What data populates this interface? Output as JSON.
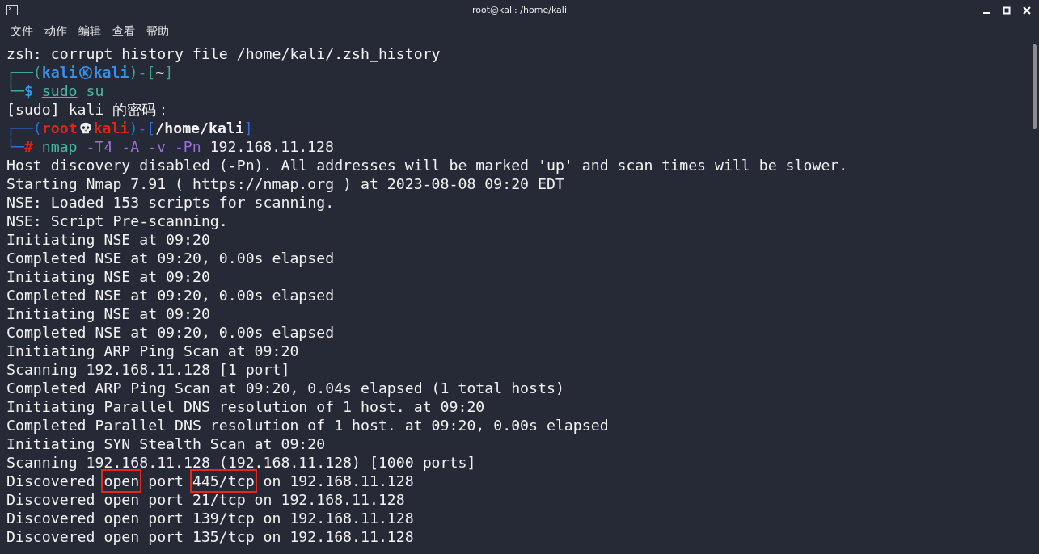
{
  "window": {
    "title": "root@kali: /home/kali"
  },
  "menu": [
    "文件",
    "动作",
    "编辑",
    "查看",
    "帮助"
  ],
  "lines": [
    {
      "kind": "output",
      "text": "zsh: corrupt history file /home/kali/.zsh_history"
    },
    {
      "kind": "prompt",
      "privileged": false,
      "open": "┌──(",
      "user": "kali",
      "host": "kali",
      "separator": ")-[",
      "path": "~",
      "close": "]",
      "corner": "└─",
      "symbol": "$",
      "command": [
        {
          "text": "sudo",
          "kind": "command",
          "underline": true
        },
        {
          "text": "su",
          "kind": "command",
          "underline": false
        }
      ]
    },
    {
      "kind": "output",
      "text": "[sudo] kali 的密码："
    },
    {
      "kind": "prompt",
      "privileged": true,
      "open": "┌──(",
      "user": "root",
      "host": "kali",
      "separator": ")-[",
      "path": "/home/kali",
      "close": "]",
      "corner": "└─",
      "symbol": "#",
      "command": [
        {
          "text": "nmap",
          "kind": "command",
          "underline": false
        },
        {
          "text": "-T4",
          "kind": "option",
          "underline": false
        },
        {
          "text": "-A",
          "kind": "option",
          "underline": false
        },
        {
          "text": "-v",
          "kind": "option",
          "underline": false
        },
        {
          "text": "-Pn",
          "kind": "option",
          "underline": false
        },
        {
          "text": "192.168.11.128",
          "kind": "argument",
          "underline": false
        }
      ]
    },
    {
      "kind": "output",
      "text": "Host discovery disabled (-Pn). All addresses will be marked 'up' and scan times will be slower."
    },
    {
      "kind": "output",
      "text": "Starting Nmap 7.91 ( https://nmap.org ) at 2023-08-08 09:20 EDT"
    },
    {
      "kind": "output",
      "text": "NSE: Loaded 153 scripts for scanning."
    },
    {
      "kind": "output",
      "text": "NSE: Script Pre-scanning."
    },
    {
      "kind": "output",
      "text": "Initiating NSE at 09:20"
    },
    {
      "kind": "output",
      "text": "Completed NSE at 09:20, 0.00s elapsed"
    },
    {
      "kind": "output",
      "text": "Initiating NSE at 09:20"
    },
    {
      "kind": "output",
      "text": "Completed NSE at 09:20, 0.00s elapsed"
    },
    {
      "kind": "output",
      "text": "Initiating NSE at 09:20"
    },
    {
      "kind": "output",
      "text": "Completed NSE at 09:20, 0.00s elapsed"
    },
    {
      "kind": "output",
      "text": "Initiating ARP Ping Scan at 09:20"
    },
    {
      "kind": "output",
      "text": "Scanning 192.168.11.128 [1 port]"
    },
    {
      "kind": "output",
      "text": "Completed ARP Ping Scan at 09:20, 0.04s elapsed (1 total hosts)"
    },
    {
      "kind": "output",
      "text": "Initiating Parallel DNS resolution of 1 host. at 09:20"
    },
    {
      "kind": "output",
      "text": "Completed Parallel DNS resolution of 1 host. at 09:20, 0.00s elapsed"
    },
    {
      "kind": "output",
      "text": "Initiating SYN Stealth Scan at 09:20"
    },
    {
      "kind": "output",
      "text": "Scanning 192.168.11.128 (192.168.11.128) [1000 ports]"
    },
    {
      "kind": "segmented",
      "segments": [
        {
          "text": "Discovered ",
          "boxed": false
        },
        {
          "text": "open",
          "boxed": true
        },
        {
          "text": " port ",
          "boxed": false
        },
        {
          "text": "445/tcp",
          "boxed": true
        },
        {
          "text": " on 192.168.11.128",
          "boxed": false
        }
      ]
    },
    {
      "kind": "output",
      "text": "Discovered open port 21/tcp on 192.168.11.128"
    },
    {
      "kind": "output",
      "text": "Discovered open port 139/tcp on 192.168.11.128"
    },
    {
      "kind": "output",
      "text": "Discovered open port 135/tcp on 192.168.11.128"
    }
  ]
}
